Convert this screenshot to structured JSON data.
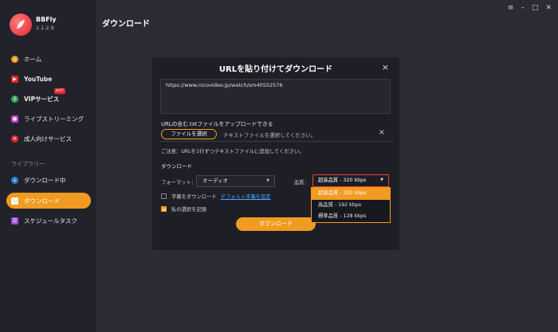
{
  "app": {
    "name": "BBFly",
    "version": "1.1.2.9"
  },
  "window": {
    "minimize": "–",
    "maximize": "□",
    "close": "✕"
  },
  "sidebar": {
    "items": [
      {
        "label": "ホーム",
        "icon": "home-icon"
      },
      {
        "label": "YouTube",
        "icon": "youtube-icon"
      },
      {
        "label": "VIPサービス",
        "icon": "key-icon",
        "badge": "HOT"
      },
      {
        "label": "ライブストリーミング",
        "icon": "live-icon"
      },
      {
        "label": "成人向けサービス",
        "icon": "adult-icon"
      }
    ],
    "library_label": "ライブラリー",
    "library_items": [
      {
        "label": "ダウンロード中",
        "icon": "download-icon"
      },
      {
        "label": "ダウンロード",
        "icon": "folder-icon"
      },
      {
        "label": "スケジュールタスク",
        "icon": "schedule-icon"
      }
    ]
  },
  "main": {
    "title": "ダウンロード"
  },
  "dialog": {
    "title": "URLを貼り付けてダウンロード",
    "close": "×",
    "url_value": "https://www.nicovideo.jp/watch/sm40552576",
    "upload_label": "URLの含む.txtファイルをアップロードできる",
    "file_button": "ファイルを選択",
    "file_placeholder": "テキストファイルを選択してください。",
    "file_clear": "×",
    "note": "ご注意：URLを1行ずつテキストファイルに追加してください。",
    "download_section": "ダウンロード",
    "format_label": "フォーマット：",
    "format_value": "オーディオ",
    "quality_label": "品質：",
    "quality_value": "超高品質 - 320 kbps",
    "quality_options": [
      "超高品質 - 320 kbps",
      "高品質 - 192 kbps",
      "標準品質 - 128 kbps"
    ],
    "subtitle_checkbox": "字幕をダウンロード",
    "subtitle_link": "デフォルト字幕を設定",
    "remember_checkbox": "私の選択を記憶",
    "download_button": "ダウンロード"
  },
  "colors": {
    "accent": "#f29b22",
    "brand": "#e8262f",
    "link": "#4aa3ff"
  }
}
